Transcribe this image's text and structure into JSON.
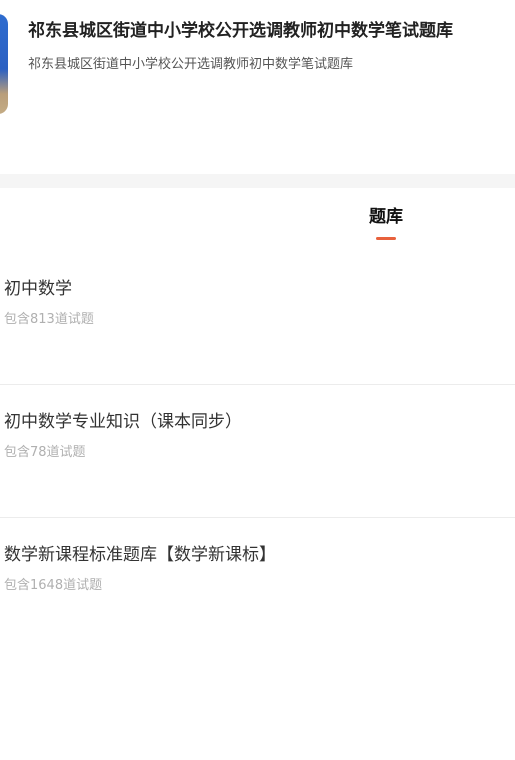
{
  "header": {
    "cover_icon": "book-cover-icon",
    "title": "祁东县城区街道中小学校公开选调教师初中数学笔试题库",
    "subtitle": "祁东县城区街道中小学校公开选调教师初中数学笔试题库"
  },
  "tabs": [
    {
      "label": "题库",
      "active": true
    }
  ],
  "colors": {
    "accent": "#e8613c",
    "title_text": "#222222",
    "muted_text": "#b0b0b0"
  },
  "items": [
    {
      "name": "初中数学",
      "count_text": "包含813道试题"
    },
    {
      "name": "初中数学专业知识（课本同步）",
      "count_text": "包含78道试题"
    },
    {
      "name": "数学新课程标准题库【数学新课标】",
      "count_text": "包含1648道试题"
    }
  ]
}
